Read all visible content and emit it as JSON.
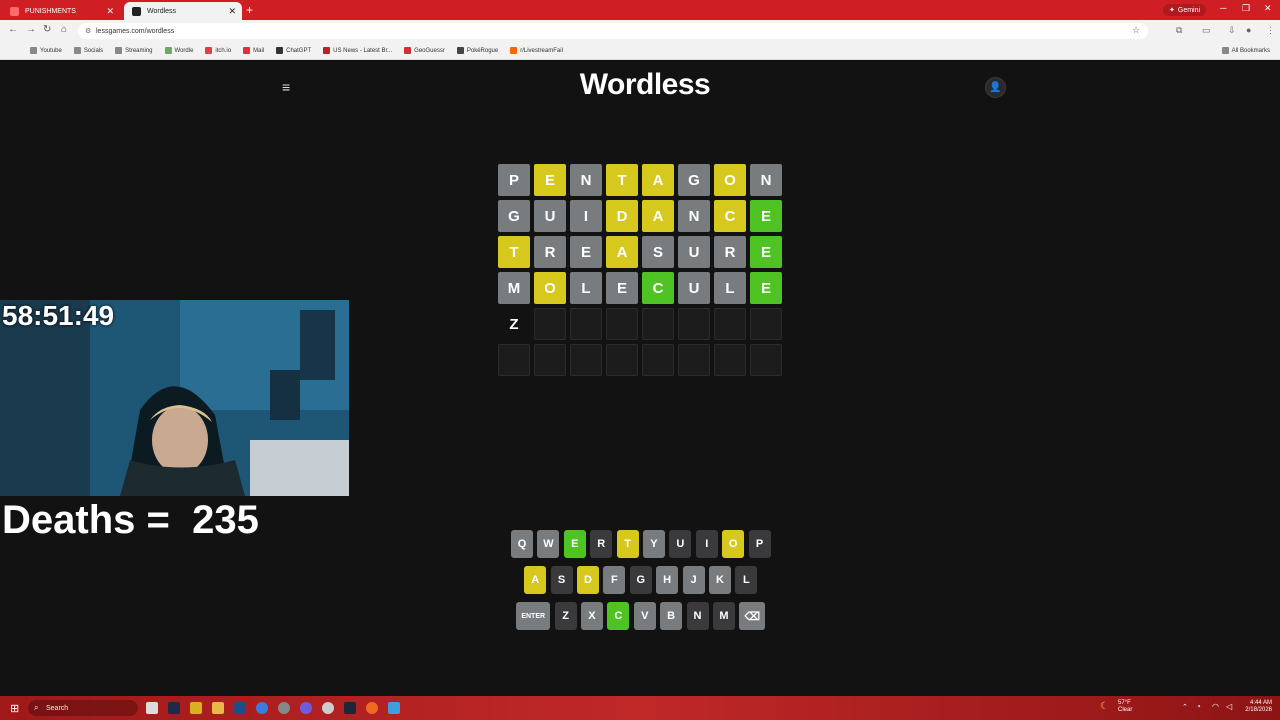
{
  "browser": {
    "tabs": [
      {
        "label": "PUNISHMENTS",
        "active": false
      },
      {
        "label": "Wordless",
        "active": true
      }
    ],
    "new_tab": "+",
    "gemini_label": "Gemini",
    "url": "lessgames.com/wordless",
    "bookmarks": [
      "Youtube",
      "Socials",
      "Streaming",
      "Wordle",
      "itch.io",
      "Mail",
      "ChatGPT",
      "US News - Latest Br...",
      "GeoGuessr",
      "PokéRogue",
      "r/LivestreamFail"
    ],
    "all_bookmarks": "All Bookmarks"
  },
  "page": {
    "title": "Wordless"
  },
  "grid": [
    [
      {
        "l": "P",
        "s": "absent"
      },
      {
        "l": "E",
        "s": "present"
      },
      {
        "l": "N",
        "s": "absent"
      },
      {
        "l": "T",
        "s": "present"
      },
      {
        "l": "A",
        "s": "present"
      },
      {
        "l": "G",
        "s": "absent"
      },
      {
        "l": "O",
        "s": "present"
      },
      {
        "l": "N",
        "s": "absent"
      }
    ],
    [
      {
        "l": "G",
        "s": "absent"
      },
      {
        "l": "U",
        "s": "absent"
      },
      {
        "l": "I",
        "s": "absent"
      },
      {
        "l": "D",
        "s": "present"
      },
      {
        "l": "A",
        "s": "present"
      },
      {
        "l": "N",
        "s": "absent"
      },
      {
        "l": "C",
        "s": "present"
      },
      {
        "l": "E",
        "s": "correct"
      }
    ],
    [
      {
        "l": "T",
        "s": "present"
      },
      {
        "l": "R",
        "s": "absent"
      },
      {
        "l": "E",
        "s": "absent"
      },
      {
        "l": "A",
        "s": "present"
      },
      {
        "l": "S",
        "s": "absent"
      },
      {
        "l": "U",
        "s": "absent"
      },
      {
        "l": "R",
        "s": "absent"
      },
      {
        "l": "E",
        "s": "correct"
      }
    ],
    [
      {
        "l": "M",
        "s": "absent"
      },
      {
        "l": "O",
        "s": "present"
      },
      {
        "l": "L",
        "s": "absent"
      },
      {
        "l": "E",
        "s": "absent"
      },
      {
        "l": "C",
        "s": "correct"
      },
      {
        "l": "U",
        "s": "absent"
      },
      {
        "l": "L",
        "s": "absent"
      },
      {
        "l": "E",
        "s": "correct"
      }
    ],
    [
      {
        "l": "Z",
        "s": "typed"
      },
      {
        "l": "",
        "s": "empty"
      },
      {
        "l": "",
        "s": "empty"
      },
      {
        "l": "",
        "s": "empty"
      },
      {
        "l": "",
        "s": "empty"
      },
      {
        "l": "",
        "s": "empty"
      },
      {
        "l": "",
        "s": "empty"
      },
      {
        "l": "",
        "s": "empty"
      }
    ],
    [
      {
        "l": "",
        "s": "empty"
      },
      {
        "l": "",
        "s": "empty"
      },
      {
        "l": "",
        "s": "empty"
      },
      {
        "l": "",
        "s": "empty"
      },
      {
        "l": "",
        "s": "empty"
      },
      {
        "l": "",
        "s": "empty"
      },
      {
        "l": "",
        "s": "empty"
      },
      {
        "l": "",
        "s": "empty"
      }
    ]
  ],
  "keyboard": [
    [
      {
        "k": "Q",
        "s": "unused"
      },
      {
        "k": "W",
        "s": "unused"
      },
      {
        "k": "E",
        "s": "correct"
      },
      {
        "k": "R",
        "s": "absent"
      },
      {
        "k": "T",
        "s": "present"
      },
      {
        "k": "Y",
        "s": "unused"
      },
      {
        "k": "U",
        "s": "absent"
      },
      {
        "k": "I",
        "s": "absent"
      },
      {
        "k": "O",
        "s": "present"
      },
      {
        "k": "P",
        "s": "absent"
      }
    ],
    [
      {
        "k": "A",
        "s": "present"
      },
      {
        "k": "S",
        "s": "absent"
      },
      {
        "k": "D",
        "s": "present"
      },
      {
        "k": "F",
        "s": "unused"
      },
      {
        "k": "G",
        "s": "absent"
      },
      {
        "k": "H",
        "s": "unused"
      },
      {
        "k": "J",
        "s": "unused"
      },
      {
        "k": "K",
        "s": "unused"
      },
      {
        "k": "L",
        "s": "absent"
      }
    ],
    [
      {
        "k": "ENTER",
        "s": "unused",
        "wide": true
      },
      {
        "k": "Z",
        "s": "absent"
      },
      {
        "k": "X",
        "s": "unused"
      },
      {
        "k": "C",
        "s": "correct"
      },
      {
        "k": "V",
        "s": "unused"
      },
      {
        "k": "B",
        "s": "unused"
      },
      {
        "k": "N",
        "s": "absent"
      },
      {
        "k": "M",
        "s": "absent"
      },
      {
        "k": "⌫",
        "s": "unused",
        "back": true
      }
    ]
  ],
  "overlay": {
    "timer": "58:51:49",
    "deaths": "Deaths =  235"
  },
  "taskbar": {
    "search": "Search",
    "weather_temp": "57°F",
    "weather_desc": "Clear",
    "time": "4:44 AM",
    "date": "2/18/2026"
  },
  "colors": {
    "absent": "#787c7e",
    "present": "#d7c81d",
    "correct": "#4fc224",
    "background": "#121213"
  }
}
